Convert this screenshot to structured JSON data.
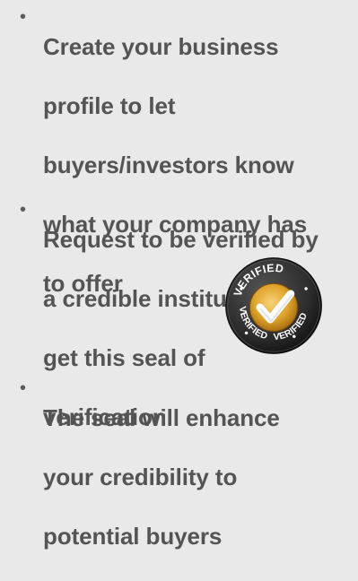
{
  "bullets": [
    {
      "lines": [
        "Create  your business",
        "profile to let",
        "buyers/investors know",
        "what your company has",
        "to offer"
      ]
    },
    {
      "lines": [
        "Request to be verified by",
        "a credible institution to",
        "get this seal of",
        "verification"
      ]
    },
    {
      "lines": [
        "The seal will enhance",
        "your credibility to",
        "potential buyers"
      ]
    }
  ],
  "bullet_char": "•",
  "seal": {
    "text_top": "VERIFIED",
    "text_right": "VERIFIED",
    "text_bottom": "VERIFIED",
    "ring_color": "#2b2b2b",
    "check_color": "#ffffff",
    "center_color": "#e0a52a"
  }
}
